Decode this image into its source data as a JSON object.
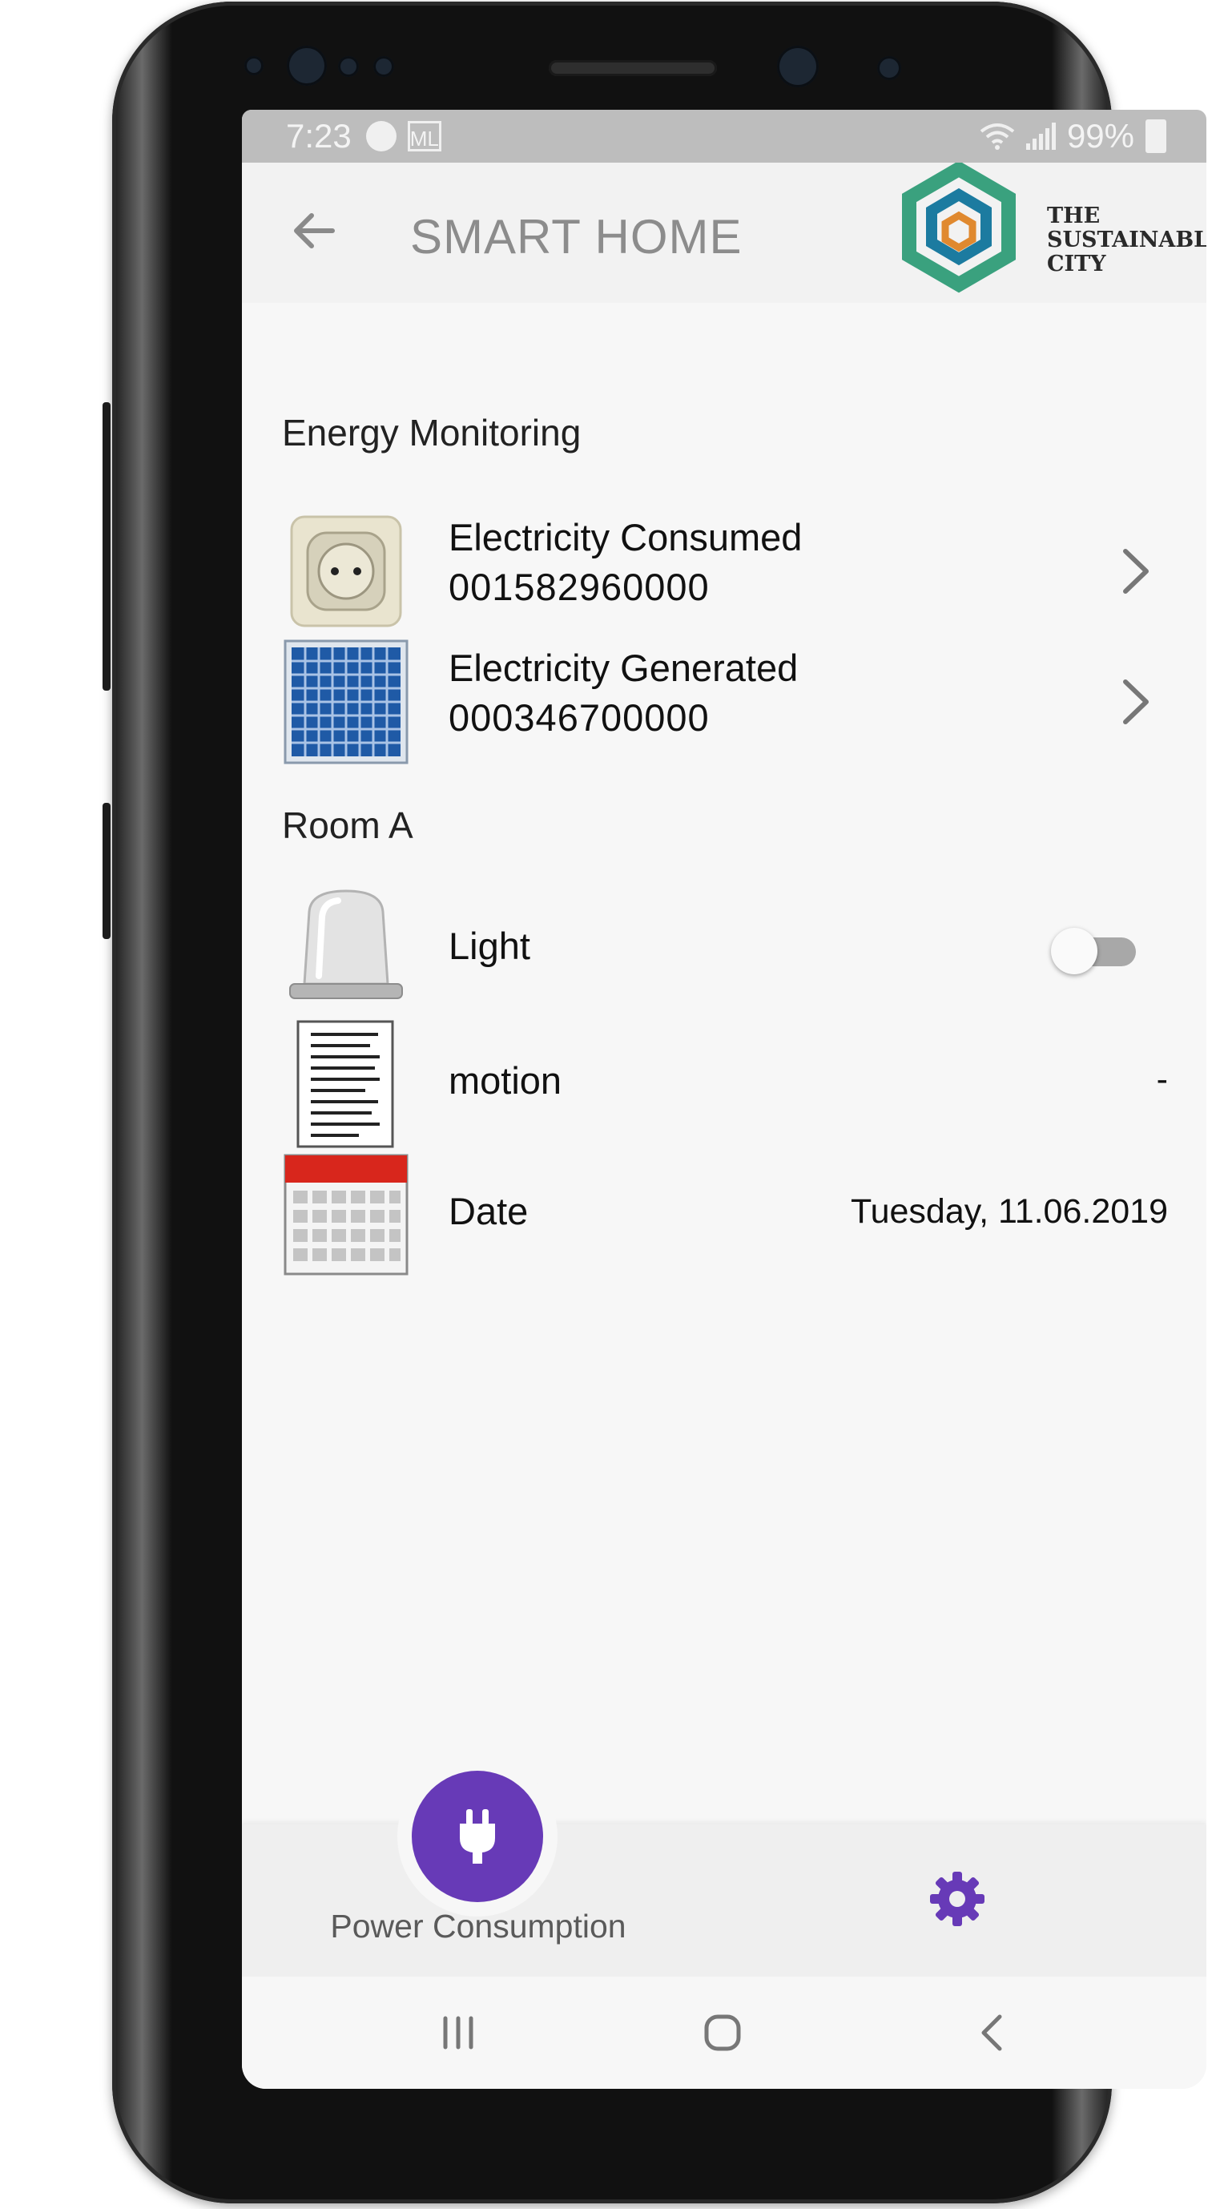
{
  "status_bar": {
    "time": "7:23",
    "battery": "99%",
    "icons": [
      "spotify-icon",
      "ml-app-icon",
      "wifi-icon",
      "signal-icon",
      "battery-icon"
    ]
  },
  "app_bar": {
    "title": "SMART HOME",
    "logo_text": [
      "THE",
      "SUSTAINABLE",
      "CITY"
    ]
  },
  "energy_section": {
    "heading": "Energy Monitoring",
    "items": [
      {
        "title": "Electricity Consumed",
        "value": "001582960000",
        "icon": "power-socket-icon"
      },
      {
        "title": "Electricity Generated",
        "value": "000346700000",
        "icon": "solar-panel-icon"
      }
    ]
  },
  "room_section": {
    "heading": "Room A",
    "items": [
      {
        "title": "Light",
        "value": "",
        "icon": "light-beacon-icon",
        "toggle_on": false
      },
      {
        "title": "motion",
        "value": "-",
        "icon": "document-icon"
      },
      {
        "title": "Date",
        "value": "Tuesday, 11.06.2019",
        "icon": "calendar-icon"
      }
    ]
  },
  "bottom_nav": {
    "fab_label": "Power Consumption",
    "fab_icon": "plug-icon",
    "settings_icon": "gear-icon"
  },
  "colors": {
    "accent": "#673ab7",
    "status_bar": "#bdbdbd",
    "app_bar": "#f2f2f2",
    "background": "#f7f7f7"
  }
}
